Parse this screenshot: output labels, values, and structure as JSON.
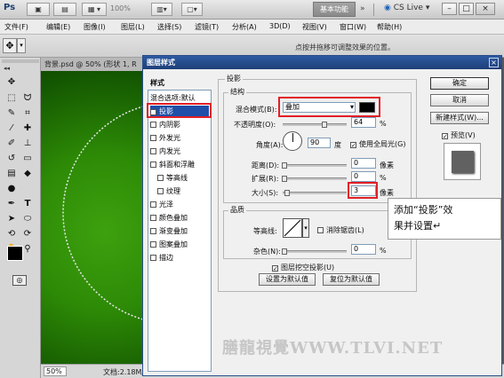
{
  "app": {
    "logo": "Ps",
    "zoom_dropdown": "100%",
    "workspace_button": "基本功能",
    "expand": "»",
    "cs_live": "CS Live",
    "win_min": "–",
    "win_max": "□",
    "win_close": "×"
  },
  "menu": [
    "文件(F)",
    "编辑(E)",
    "图像(I)",
    "图层(L)",
    "选择(S)",
    "滤镜(T)",
    "分析(A)",
    "3D(D)",
    "视图(V)",
    "窗口(W)",
    "帮助(H)"
  ],
  "options_bar": {
    "hint": "点按并拖移可调整效果的位置。"
  },
  "document": {
    "tab_label": "背景.psd @ 50% (形状 1, R",
    "zoom": "50%",
    "doc_info": "文档:2.18M/8.43M"
  },
  "dialog": {
    "title": "图层样式",
    "styles_header": "样式",
    "styles": [
      {
        "label": "混合选项:默认",
        "checkbox": false,
        "checked": false
      },
      {
        "label": "投影",
        "checkbox": true,
        "checked": true
      },
      {
        "label": "内阴影",
        "checkbox": true,
        "checked": false
      },
      {
        "label": "外发光",
        "checkbox": true,
        "checked": false
      },
      {
        "label": "内发光",
        "checkbox": true,
        "checked": false
      },
      {
        "label": "斜面和浮雕",
        "checkbox": true,
        "checked": false
      },
      {
        "label": "等高线",
        "checkbox": true,
        "checked": false
      },
      {
        "label": "纹理",
        "checkbox": true,
        "checked": false
      },
      {
        "label": "光泽",
        "checkbox": true,
        "checked": false
      },
      {
        "label": "颜色叠加",
        "checkbox": true,
        "checked": false
      },
      {
        "label": "渐变叠加",
        "checkbox": true,
        "checked": false
      },
      {
        "label": "图案叠加",
        "checkbox": true,
        "checked": false
      },
      {
        "label": "描边",
        "checkbox": true,
        "checked": false
      }
    ],
    "section_title": "投影",
    "structure_title": "结构",
    "blend_mode_label": "混合模式(B):",
    "blend_mode_value": "叠加",
    "shadow_color": "#000000",
    "opacity_label": "不透明度(O):",
    "opacity_value": "64",
    "opacity_unit": "%",
    "angle_label": "角度(A):",
    "angle_value": "90",
    "angle_unit": "度",
    "use_global_light": "使用全局光(G)",
    "distance_label": "距离(D):",
    "distance_value": "0",
    "distance_unit": "像素",
    "spread_label": "扩展(R):",
    "spread_value": "0",
    "spread_unit": "%",
    "size_label": "大小(S):",
    "size_value": "3",
    "size_unit": "像素",
    "quality_title": "品质",
    "contour_label": "等高线:",
    "anti_alias": "消除锯齿(L)",
    "noise_label": "杂色(N):",
    "noise_value": "0",
    "noise_unit": "%",
    "layer_knocks_out": "图层挖空投影(U)",
    "make_default": "设置为默认值",
    "reset_default": "复位为默认值",
    "ok": "确定",
    "cancel": "取消",
    "new_style": "新建样式(W)...",
    "preview": "预览(V)"
  },
  "callout": {
    "line1": "添加“投影”效",
    "line2": "果并设置↵"
  },
  "watermark": "膳龍視覺WWW.TLVI.NET",
  "colors": {
    "accent_red": "#e21f26",
    "dialog_title": "#2e5aa2"
  }
}
